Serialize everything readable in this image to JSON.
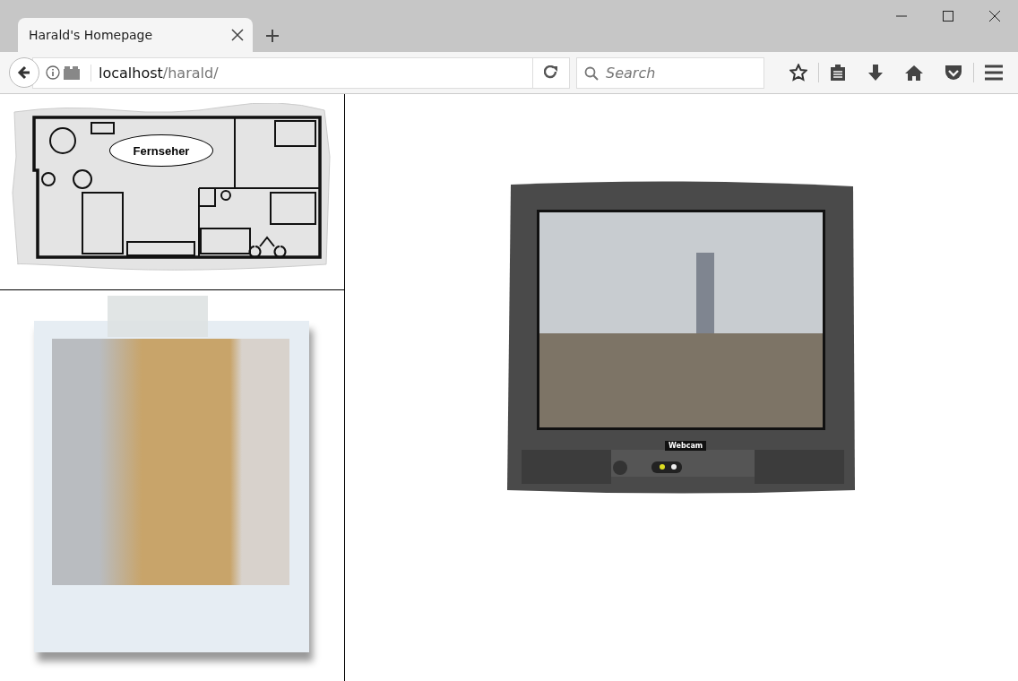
{
  "tabs": [
    {
      "title": "Harald's Homepage",
      "selected": true
    }
  ],
  "address_bar": {
    "host": "localhost",
    "path": "/harald/"
  },
  "search": {
    "placeholder": "Search"
  },
  "floor_plan": {
    "callout": "Fernseher"
  },
  "tv": {
    "label": "Webcam"
  }
}
